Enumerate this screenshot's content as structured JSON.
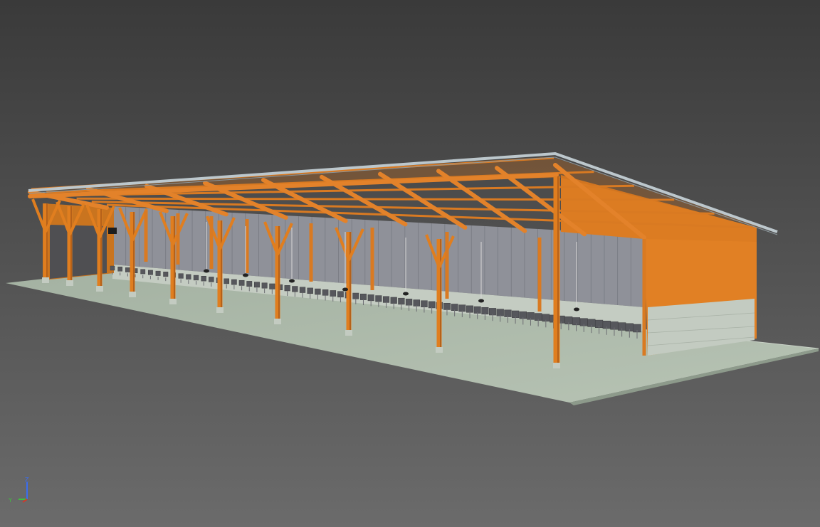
{
  "viewport": {
    "background_top": "#3a3a3a",
    "background_bottom": "#6a6a6a"
  },
  "model": {
    "timber_color": "#e07e1f",
    "timber_dark": "#b5611a",
    "floor_color": "#aab7a8",
    "wall_color": "#c2cbc0",
    "roof_edge_color": "#b9c4ca",
    "curtain_color": "#8e9098",
    "feeder_color": "#5a5a5e"
  },
  "axis_gizmo": {
    "z_label": "Z",
    "y_label": "Y",
    "z_color": "#3a6df0",
    "y_color": "#3fbf3f",
    "x_color": "#d03a2a"
  }
}
